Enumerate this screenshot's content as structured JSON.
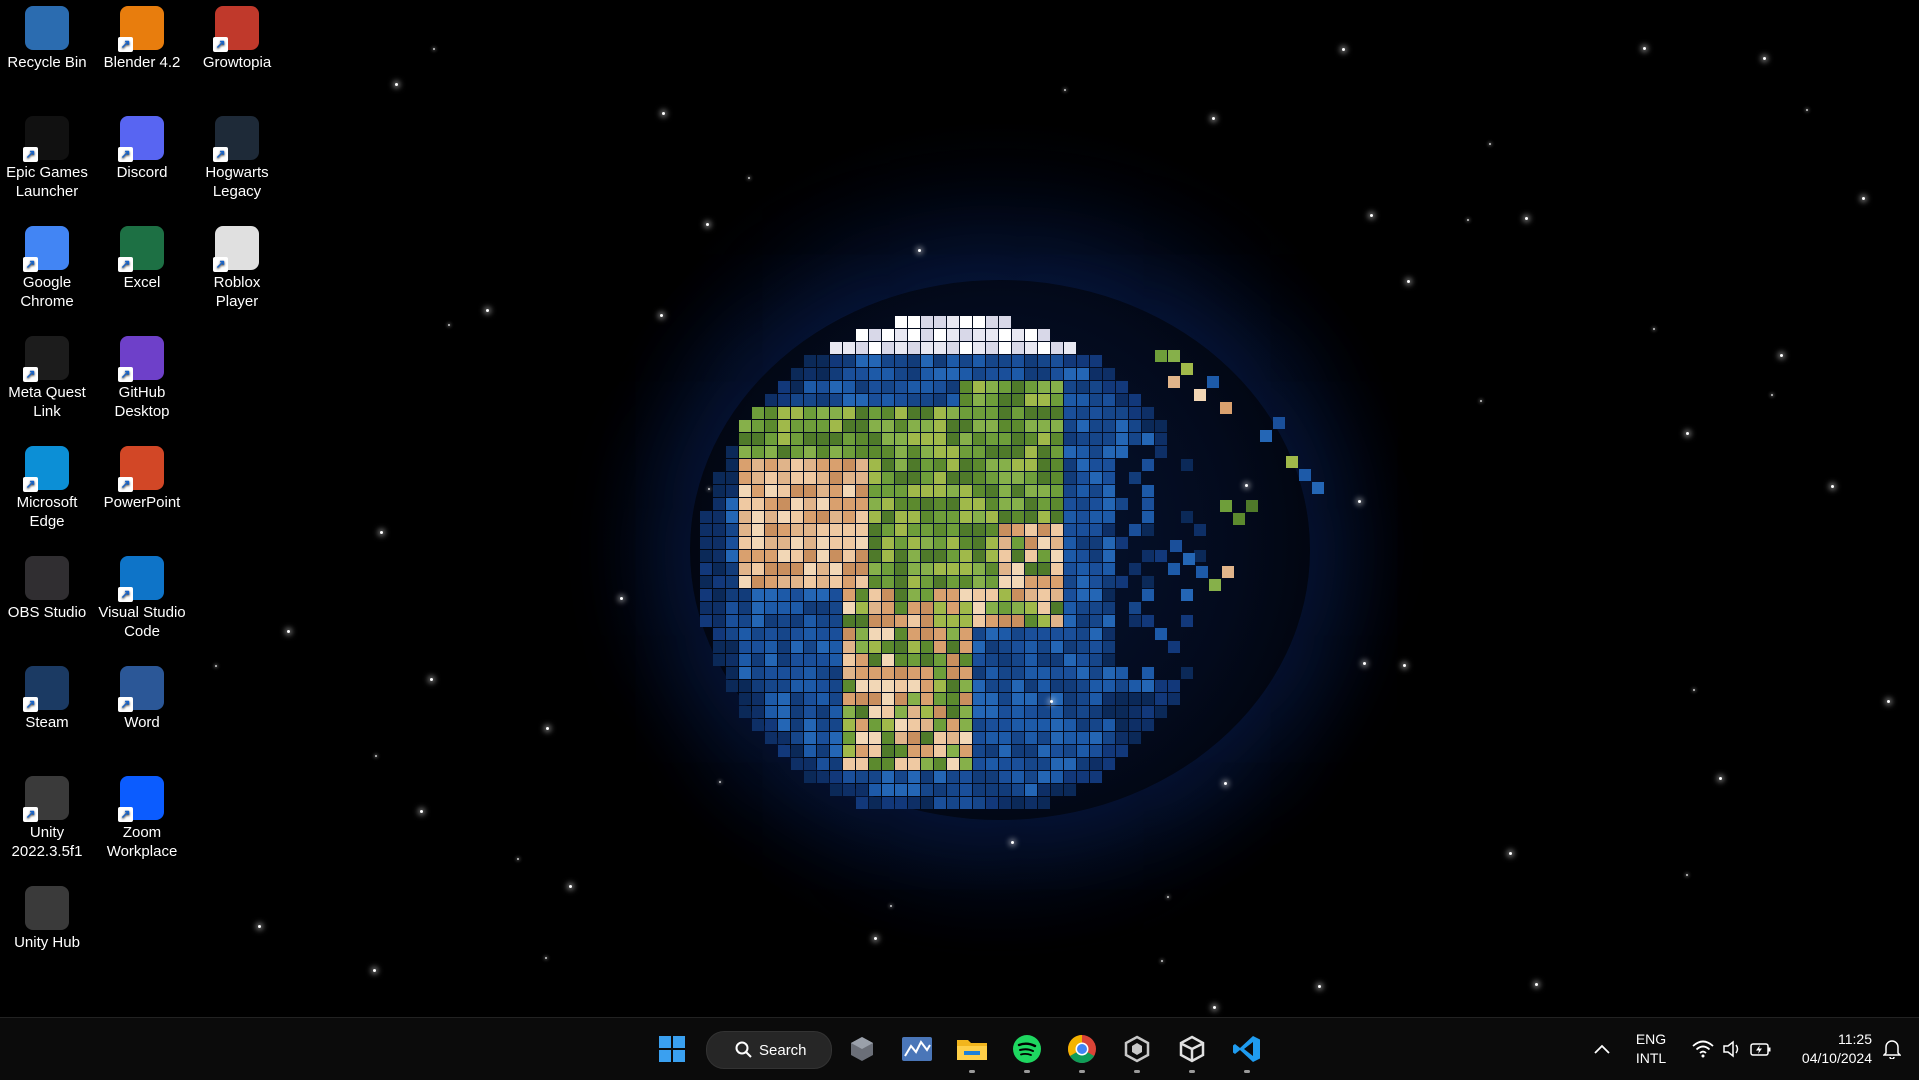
{
  "desktop_icons": [
    {
      "label": "Recycle Bin",
      "icon": "recycle-bin-icon",
      "color": "#2b6cb0",
      "shortcut": false
    },
    {
      "label": "Blender 4.2",
      "icon": "blender-icon",
      "color": "#e87d0d",
      "shortcut": true
    },
    {
      "label": "Growtopia",
      "icon": "growtopia-icon",
      "color": "#c0392b",
      "shortcut": true
    },
    {
      "label": "Epic Games Launcher",
      "icon": "epic-games-icon",
      "color": "#111111",
      "shortcut": true
    },
    {
      "label": "Discord",
      "icon": "discord-icon",
      "color": "#5865f2",
      "shortcut": true
    },
    {
      "label": "Hogwarts Legacy",
      "icon": "hogwarts-legacy-icon",
      "color": "#1e2a38",
      "shortcut": true
    },
    {
      "label": "Google Chrome",
      "icon": "chrome-icon",
      "color": "#4285f4",
      "shortcut": true
    },
    {
      "label": "Excel",
      "icon": "excel-icon",
      "color": "#1d7044",
      "shortcut": true
    },
    {
      "label": "Roblox Player",
      "icon": "roblox-icon",
      "color": "#e0e0e0",
      "shortcut": true
    },
    {
      "label": "Meta Quest Link",
      "icon": "meta-quest-icon",
      "color": "#1c1c1c",
      "shortcut": true
    },
    {
      "label": "GitHub Desktop",
      "icon": "github-desktop-icon",
      "color": "#6e40c9",
      "shortcut": true
    },
    {
      "label": "Microsoft Edge",
      "icon": "edge-icon",
      "color": "#0c8fd6",
      "shortcut": true
    },
    {
      "label": "PowerPoint",
      "icon": "powerpoint-icon",
      "color": "#d24726",
      "shortcut": true
    },
    {
      "label": "OBS Studio",
      "icon": "obs-studio-icon",
      "color": "#302e31",
      "shortcut": false
    },
    {
      "label": "Visual Studio Code",
      "icon": "vscode-icon",
      "color": "#0e74c8",
      "shortcut": true
    },
    {
      "label": "Steam",
      "icon": "steam-icon",
      "color": "#1b3a63",
      "shortcut": true
    },
    {
      "label": "Word",
      "icon": "word-icon",
      "color": "#2b5797",
      "shortcut": true
    },
    {
      "label": "Unity 2022.3.5f1",
      "icon": "unity-icon",
      "color": "#3a3a3a",
      "shortcut": true
    },
    {
      "label": "Zoom Workplace",
      "icon": "zoom-icon",
      "color": "#0b5cff",
      "shortcut": true
    },
    {
      "label": "Unity Hub",
      "icon": "unity-hub-icon",
      "color": "#3a3a3a",
      "shortcut": false
    }
  ],
  "taskbar": {
    "search_label": "Search",
    "apps": [
      {
        "name": "start-button",
        "icon": "windows-logo-icon",
        "running": false
      },
      {
        "name": "taskbar-unity",
        "icon": "unity-icon",
        "running": false
      },
      {
        "name": "taskbar-stocks",
        "icon": "chart-icon",
        "running": false
      },
      {
        "name": "taskbar-file-explorer",
        "icon": "folder-icon",
        "running": true
      },
      {
        "name": "taskbar-spotify",
        "icon": "spotify-icon",
        "running": true
      },
      {
        "name": "taskbar-chrome",
        "icon": "chrome-icon",
        "running": true
      },
      {
        "name": "taskbar-unity-hub",
        "icon": "unity-hub-icon",
        "running": true
      },
      {
        "name": "taskbar-unity-editor",
        "icon": "unity-editor-icon",
        "running": true
      },
      {
        "name": "taskbar-vscode",
        "icon": "vscode-icon",
        "running": true
      }
    ],
    "tray": {
      "language_line1": "ENG",
      "language_line2": "INTL",
      "time": "11:25",
      "date": "04/10/2024"
    }
  }
}
